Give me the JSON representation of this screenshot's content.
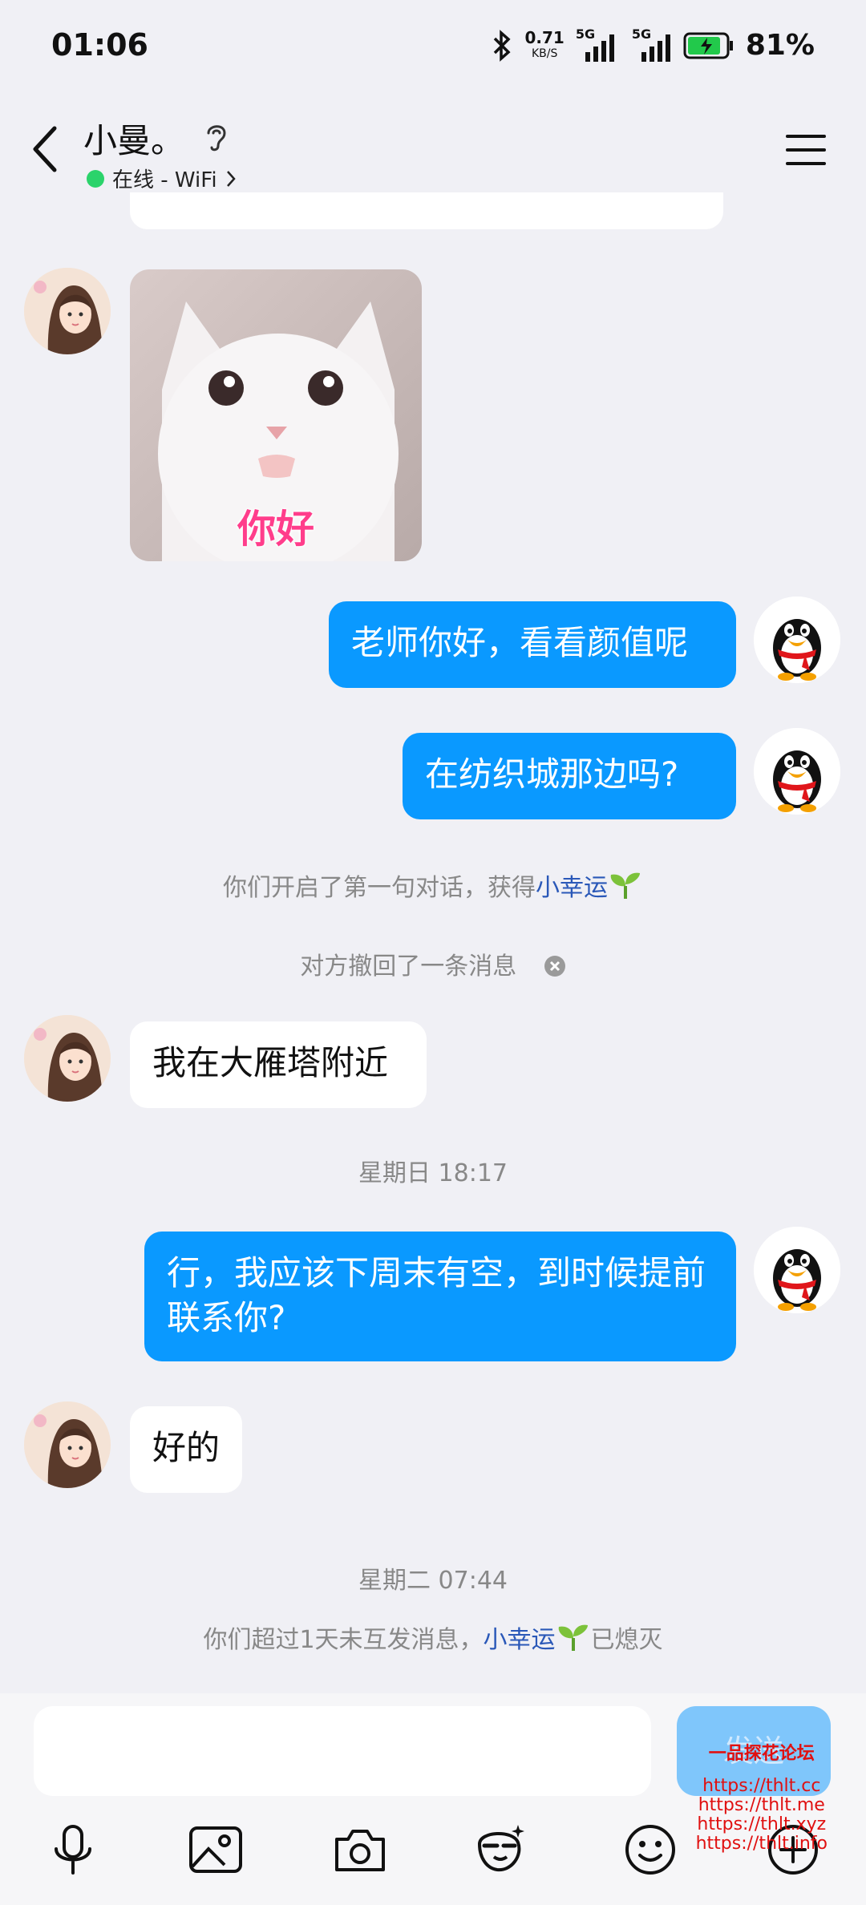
{
  "status_bar": {
    "time": "01:06",
    "net_speed_value": "0.71",
    "net_speed_unit": "KB/S",
    "sim1_label": "5G",
    "sim2_label": "5G",
    "battery_pct": "81%"
  },
  "header": {
    "contact_name": "小曼。",
    "presence": "在线 - WiFi",
    "presence_color": "#2bd36b"
  },
  "messages": {
    "sticker_caption": "你好",
    "out1": "老师你好，看看颜值呢",
    "out2": "在纺织城那边吗?",
    "system1_prefix": "你们开启了第一句对话，获得",
    "system1_lucky": "小幸运",
    "recall": "对方撤回了一条消息",
    "in1": "我在大雁塔附近",
    "ts1": "星期日 18:17",
    "out3": "行，我应该下周末有空，到时候提前联系你?",
    "in2": "好的",
    "ts2": "星期二 07:44",
    "system2_prefix": "你们超过1天未互发消息，",
    "system2_lucky": "小幸运",
    "system2_suffix": "已熄灭"
  },
  "composer": {
    "send_label": "发送"
  },
  "toolbar": {
    "icons": [
      "mic-icon",
      "image-icon",
      "camera-icon",
      "sticker-icon",
      "emoji-icon",
      "plus-icon"
    ]
  },
  "watermark": {
    "title": "一品探花论坛",
    "lines": [
      "https://thlt.cc",
      "https://thlt.me",
      "https://thlt.xyz",
      "https://thlt.info"
    ]
  },
  "colors": {
    "outgoing_bubble": "#0a99ff",
    "incoming_bubble": "#ffffff",
    "background": "#f0f0f5",
    "lucky_link": "#2a58b8"
  }
}
